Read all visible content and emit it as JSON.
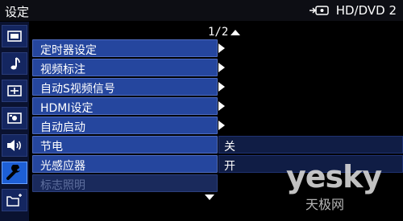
{
  "header": {
    "title": "设定",
    "source_label": "HD/DVD 2",
    "source_icon": "input-source-icon"
  },
  "sidebar": {
    "items": [
      {
        "icon": "picture-icon",
        "active": false
      },
      {
        "icon": "music-note-icon",
        "active": false
      },
      {
        "icon": "screen-adjust-icon",
        "active": false
      },
      {
        "icon": "photo-icon",
        "active": false
      },
      {
        "icon": "speaker-volume-icon",
        "active": false
      },
      {
        "icon": "wrench-icon",
        "active": true
      },
      {
        "icon": "folder-icon",
        "active": false
      }
    ]
  },
  "menu": {
    "page_indicator": "1/2",
    "items": [
      {
        "label": "定时器设定",
        "submenu": true
      },
      {
        "label": "视频标注",
        "submenu": true
      },
      {
        "label": "自动S视频信号",
        "submenu": true
      },
      {
        "label": "HDMI设定",
        "submenu": true
      },
      {
        "label": "自动启动",
        "submenu": true
      },
      {
        "label": "节电",
        "value": "关"
      },
      {
        "label": "光感应器",
        "value": "开"
      },
      {
        "label": "标志照明",
        "disabled": true
      }
    ]
  },
  "watermark": {
    "main": "yesky",
    "sub": "天极网"
  },
  "colors": {
    "row_bg": "#25469e",
    "active_tab": "#1d5fd6",
    "value_bar": "#101d45",
    "disabled_text": "#5e6f9e"
  }
}
